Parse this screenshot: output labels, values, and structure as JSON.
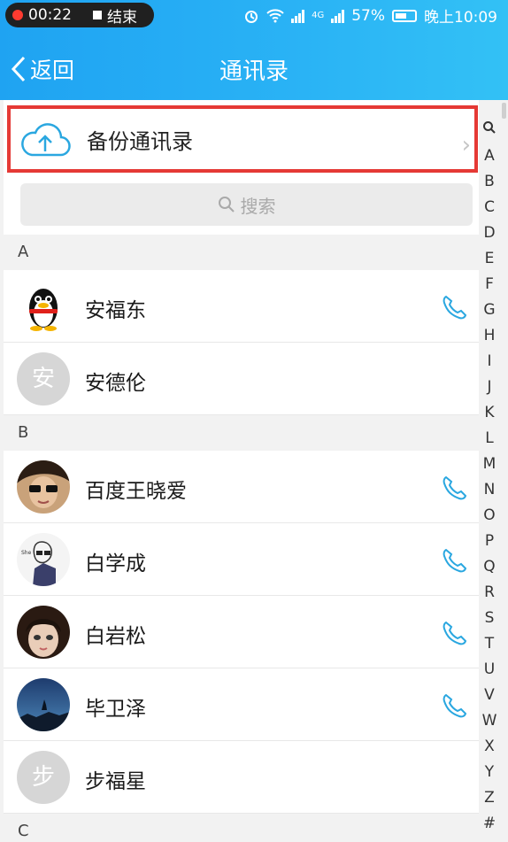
{
  "status_bar": {
    "time": "00:22",
    "stop_label": "结束",
    "signal_4g": "4G",
    "battery": "57%",
    "clock": "晚上10:09"
  },
  "nav": {
    "back_label": "返回",
    "title": "通讯录"
  },
  "backup": {
    "label": "备份通讯录"
  },
  "search": {
    "placeholder": "搜索"
  },
  "sections": [
    {
      "letter": "A",
      "contacts": [
        {
          "name": "安福东",
          "avatar": "qq-penguin",
          "has_phone": true
        },
        {
          "name": "安德伦",
          "avatar_text": "安",
          "has_phone": false
        }
      ]
    },
    {
      "letter": "B",
      "contacts": [
        {
          "name": "百度王晓爱",
          "avatar": "photo",
          "has_phone": true
        },
        {
          "name": "白学成",
          "avatar": "sketch",
          "has_phone": true
        },
        {
          "name": "白岩松",
          "avatar": "photo",
          "has_phone": true
        },
        {
          "name": "毕卫泽",
          "avatar": "night-sky",
          "has_phone": true
        },
        {
          "name": "步福星",
          "avatar_text": "步",
          "has_phone": false
        }
      ]
    },
    {
      "letter": "C",
      "contacts": []
    }
  ],
  "index_letters": [
    "A",
    "B",
    "C",
    "D",
    "E",
    "F",
    "G",
    "H",
    "I",
    "J",
    "K",
    "L",
    "M",
    "N",
    "O",
    "P",
    "Q",
    "R",
    "S",
    "T",
    "U",
    "V",
    "W",
    "X",
    "Y",
    "Z",
    "#"
  ],
  "colors": {
    "header": "#1fa3f2",
    "accent_phone": "#2aa7e0",
    "highlight_border": "#e53935"
  }
}
